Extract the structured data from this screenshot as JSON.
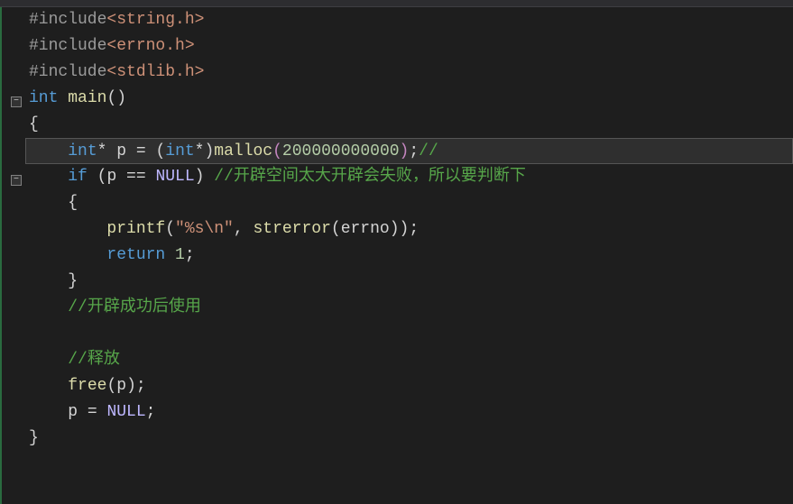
{
  "code": {
    "l1": {
      "inc": "#include",
      "hdr": "<string.h>"
    },
    "l2": {
      "inc": "#include",
      "hdr": "<errno.h>"
    },
    "l3": {
      "inc": "#include",
      "hdr": "<stdlib.h>"
    },
    "l4": {
      "kw": "int",
      "fn": "main",
      "paren": "()"
    },
    "l5": {
      "brace": "{"
    },
    "l6": {
      "indent": "    ",
      "type": "int",
      "star": "* ",
      "var": "p ",
      "eq": "= ",
      "lp": "(",
      "cast": "int",
      "star2": "*",
      "rp": ")",
      "call": "malloc",
      "args_open": "(",
      "num": "200000000000",
      "args_close": ")",
      "semi": ";",
      "cmt": "//"
    },
    "l7": {
      "indent": "    ",
      "kw": "if ",
      "lp": "(",
      "var": "p ",
      "eq": "== ",
      "null": "NULL",
      "rp": ") ",
      "cmt": "//开辟空间太大开辟会失败，所以要判断下"
    },
    "l8": {
      "indent": "    ",
      "brace": "{"
    },
    "l9": {
      "indent": "        ",
      "fn": "printf",
      "lp": "(",
      "str": "\"%s\\n\"",
      "comma": ", ",
      "fn2": "strerror",
      "lp2": "(",
      "arg": "errno",
      "rp2": ")",
      "rp": ")",
      "semi": ";"
    },
    "l10": {
      "indent": "        ",
      "kw": "return ",
      "num": "1",
      "semi": ";"
    },
    "l11": {
      "indent": "    ",
      "brace": "}"
    },
    "l12": {
      "indent": "    ",
      "cmt": "//开辟成功后使用"
    },
    "l13": {
      "indent": "    "
    },
    "l14": {
      "indent": "    ",
      "cmt": "//释放"
    },
    "l15": {
      "indent": "    ",
      "fn": "free",
      "lp": "(",
      "arg": "p",
      "rp": ")",
      "semi": ";"
    },
    "l16": {
      "indent": "    ",
      "var": "p ",
      "eq": "= ",
      "null": "NULL",
      "semi": ";"
    },
    "l17": {
      "brace": "}"
    }
  },
  "fold": {
    "minus": "−"
  }
}
